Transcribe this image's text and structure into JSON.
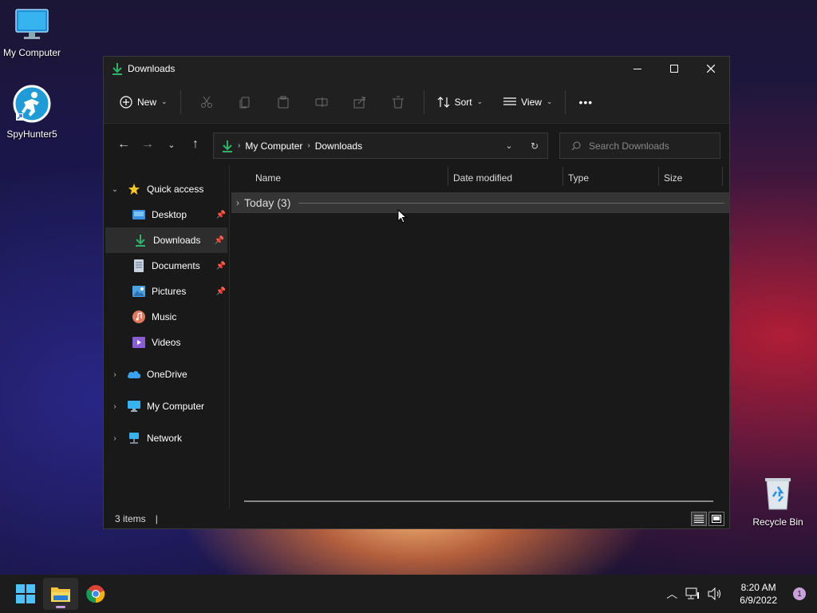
{
  "desktop": {
    "icons": [
      {
        "label": "My Computer"
      },
      {
        "label": "SpyHunter5"
      },
      {
        "label": "Recycle Bin"
      }
    ]
  },
  "window": {
    "title": "Downloads",
    "toolbar": {
      "new_label": "New",
      "sort_label": "Sort",
      "view_label": "View",
      "more_label": "•••"
    },
    "address": {
      "crumbs": [
        "My Computer",
        "Downloads"
      ]
    },
    "search": {
      "placeholder": "Search Downloads"
    },
    "sidebar": {
      "quick_access": "Quick access",
      "items": [
        {
          "label": "Desktop",
          "pinned": true
        },
        {
          "label": "Downloads",
          "pinned": true,
          "selected": true
        },
        {
          "label": "Documents",
          "pinned": true
        },
        {
          "label": "Pictures",
          "pinned": true
        },
        {
          "label": "Music",
          "pinned": false
        },
        {
          "label": "Videos",
          "pinned": false
        }
      ],
      "roots": [
        {
          "label": "OneDrive"
        },
        {
          "label": "My Computer"
        },
        {
          "label": "Network"
        }
      ]
    },
    "columns": [
      "Name",
      "Date modified",
      "Type",
      "Size"
    ],
    "group": {
      "label": "Today (3)"
    },
    "status": {
      "items": "3 items"
    }
  },
  "taskbar": {
    "time": "8:20 AM",
    "date": "6/9/2022",
    "notification_count": "1"
  },
  "colors": {
    "accent_download": "#2fb36b",
    "folder_blue": "#4aa3df",
    "window_bg": "#191919"
  }
}
